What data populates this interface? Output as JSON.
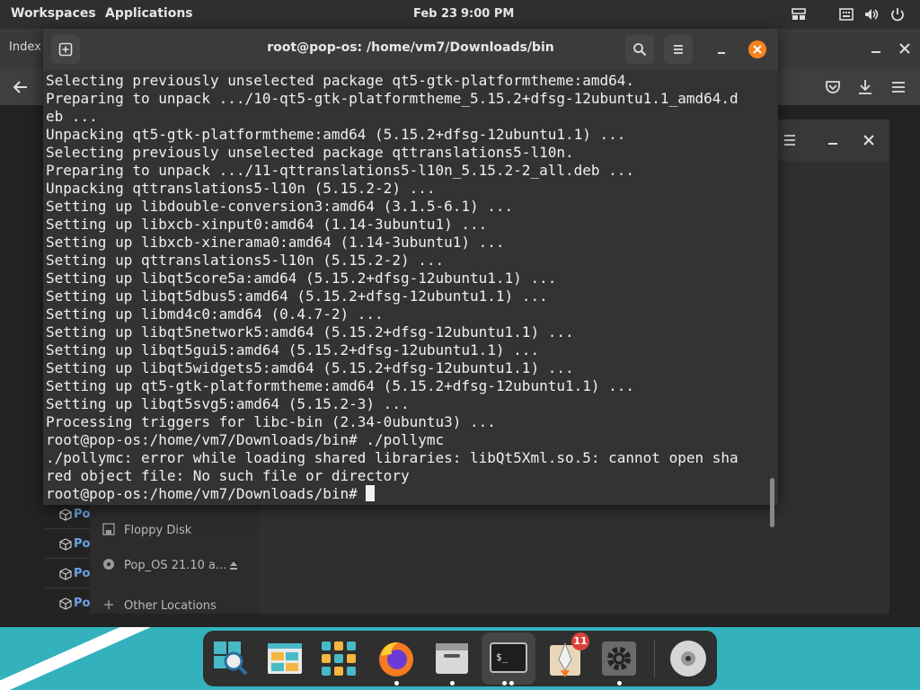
{
  "topbar": {
    "workspaces": "Workspaces",
    "applications": "Applications",
    "date": "Feb 23",
    "time": "9:00 PM"
  },
  "browser": {
    "tab_title": "Index o"
  },
  "files": {
    "sidebar": [
      {
        "label": "Floppy Disk",
        "icon": "floppy-icon"
      },
      {
        "label": "Pop_OS 21.10 a...",
        "icon": "disc-icon"
      },
      {
        "label": "Other Locations",
        "icon": "plus-icon"
      }
    ],
    "po_items": [
      "Po",
      "Po",
      "Po",
      "Po"
    ]
  },
  "terminal": {
    "title": "root@pop-os: /home/vm7/Downloads/bin",
    "lines": [
      "Selecting previously unselected package qt5-gtk-platformtheme:amd64.",
      "Preparing to unpack .../10-qt5-gtk-platformtheme_5.15.2+dfsg-12ubuntu1.1_amd64.d",
      "eb ...",
      "Unpacking qt5-gtk-platformtheme:amd64 (5.15.2+dfsg-12ubuntu1.1) ...",
      "Selecting previously unselected package qttranslations5-l10n.",
      "Preparing to unpack .../11-qttranslations5-l10n_5.15.2-2_all.deb ...",
      "Unpacking qttranslations5-l10n (5.15.2-2) ...",
      "Setting up libdouble-conversion3:amd64 (3.1.5-6.1) ...",
      "Setting up libxcb-xinput0:amd64 (1.14-3ubuntu1) ...",
      "Setting up libxcb-xinerama0:amd64 (1.14-3ubuntu1) ...",
      "Setting up qttranslations5-l10n (5.15.2-2) ...",
      "Setting up libqt5core5a:amd64 (5.15.2+dfsg-12ubuntu1.1) ...",
      "Setting up libqt5dbus5:amd64 (5.15.2+dfsg-12ubuntu1.1) ...",
      "Setting up libmd4c0:amd64 (0.4.7-2) ...",
      "Setting up libqt5network5:amd64 (5.15.2+dfsg-12ubuntu1.1) ...",
      "Setting up libqt5gui5:amd64 (5.15.2+dfsg-12ubuntu1.1) ...",
      "Setting up libqt5widgets5:amd64 (5.15.2+dfsg-12ubuntu1.1) ...",
      "Setting up qt5-gtk-platformtheme:amd64 (5.15.2+dfsg-12ubuntu1.1) ...",
      "Setting up libqt5svg5:amd64 (5.15.2-3) ...",
      "Processing triggers for libc-bin (2.34-0ubuntu3) ...",
      "root@pop-os:/home/vm7/Downloads/bin# ./pollymc",
      "./pollymc: error while loading shared libraries: libQt5Xml.so.5: cannot open sha",
      "red object file: No such file or directory"
    ],
    "prompt": "root@pop-os:/home/vm7/Downloads/bin# "
  },
  "dock": {
    "apps": [
      {
        "name": "pop-shop-icon"
      },
      {
        "name": "workspaces-icon"
      },
      {
        "name": "app-grid-icon"
      },
      {
        "name": "firefox-icon"
      },
      {
        "name": "files-icon"
      },
      {
        "name": "terminal-icon"
      },
      {
        "name": "launcher-icon"
      },
      {
        "name": "settings-icon"
      },
      {
        "name": "disc-icon"
      }
    ],
    "badge_count": "11"
  },
  "colors": {
    "accent_close": "#f6821f",
    "dock_bg": "#33b2be",
    "link_blue": "#6aa4e6"
  }
}
